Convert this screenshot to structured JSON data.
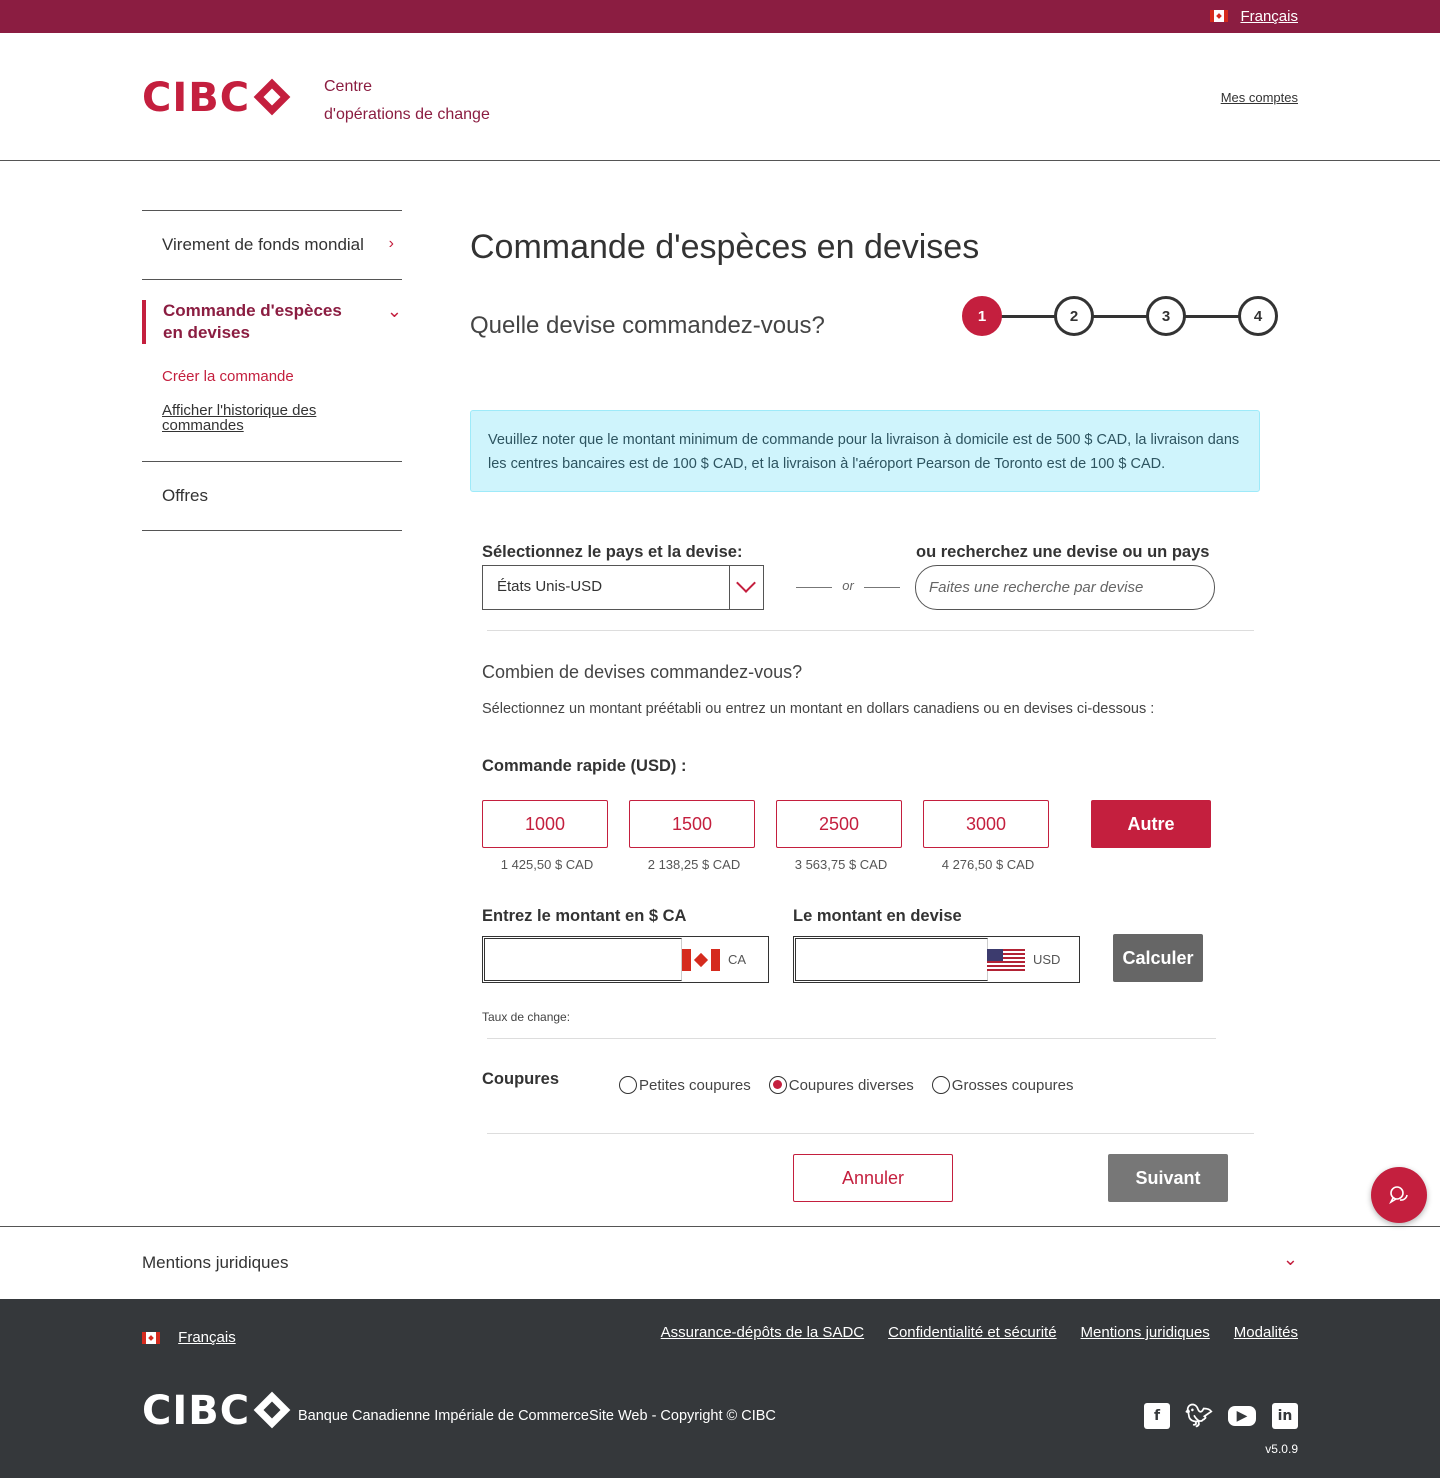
{
  "topbar": {
    "language": "Français"
  },
  "header": {
    "logo_text": "CIBC",
    "subtitle_line1": "Centre",
    "subtitle_line2": "d'opérations de change",
    "my_accounts": "Mes comptes"
  },
  "sidebar": {
    "items": [
      {
        "label": "Virement de fonds mondial"
      },
      {
        "label": "Commande d'espèces en devises"
      },
      {
        "label": "Offres"
      }
    ],
    "sub_items": [
      {
        "label": "Créer la commande"
      },
      {
        "label": "Afficher l'historique des commandes"
      }
    ]
  },
  "main": {
    "title": "Commande d'espèces en devises",
    "step_question": "Quelle devise commandez-vous?",
    "steps": [
      "1",
      "2",
      "3",
      "4"
    ],
    "active_step": 1,
    "notice": "Veuillez noter que le montant minimum de commande pour la livraison à domicile est de 500 $ CAD, la livraison dans les centres bancaires est de 100 $ CAD, et la livraison à l'aéroport Pearson de Toronto est de 100 $ CAD.",
    "select_label": "Sélectionnez le pays et la devise:",
    "select_value": "États Unis-USD",
    "or_text": "or",
    "search_label": "ou recherchez une devise ou un pays",
    "search_placeholder": "Faites une recherche par devise",
    "amount_question": "Combien de devises commandez-vous?",
    "amount_help": "Sélectionnez un montant préétabli ou entrez un montant en dollars canadiens ou en devises ci-dessous :",
    "quick_order_label": "Commande rapide (USD) :",
    "presets": [
      {
        "amount": "1000",
        "cad": "1 425,50 $ CAD"
      },
      {
        "amount": "1500",
        "cad": "2 138,25 $ CAD"
      },
      {
        "amount": "2500",
        "cad": "3 563,75 $ CAD"
      },
      {
        "amount": "3000",
        "cad": "4 276,50 $ CAD"
      }
    ],
    "other_label": "Autre",
    "cad_amount_label": "Entrez le montant en $ CA",
    "cad_amount_value": "",
    "cad_code": "CA",
    "fx_amount_label": "Le montant en devise",
    "fx_amount_value": "",
    "fx_code": "USD",
    "calculate_label": "Calculer",
    "rate_label": "Taux de change:",
    "denominations_label": "Coupures",
    "denominations": [
      {
        "label": "Petites coupures",
        "selected": false
      },
      {
        "label": "Coupures diverses",
        "selected": true
      },
      {
        "label": "Grosses coupures",
        "selected": false
      }
    ],
    "cancel_label": "Annuler",
    "next_label": "Suivant"
  },
  "legal": {
    "label": "Mentions juridiques"
  },
  "footer": {
    "language": "Français",
    "links": [
      "Assurance-dépôts de la SADC",
      "Confidentialité et sécurité",
      "Mentions juridiques",
      "Modalités"
    ],
    "logo_text": "CIBC",
    "copyright": "Banque Canadienne Impériale de CommerceSite Web - Copyright © CIBC",
    "socials": [
      "facebook-icon",
      "twitter-icon",
      "youtube-icon",
      "linkedin-icon"
    ],
    "version": "v5.0.9"
  },
  "colors": {
    "brand": "#c41f3e",
    "brand_dark": "#8b1d41",
    "footer_bg": "#35383b",
    "notice_bg": "#cff4fc"
  }
}
